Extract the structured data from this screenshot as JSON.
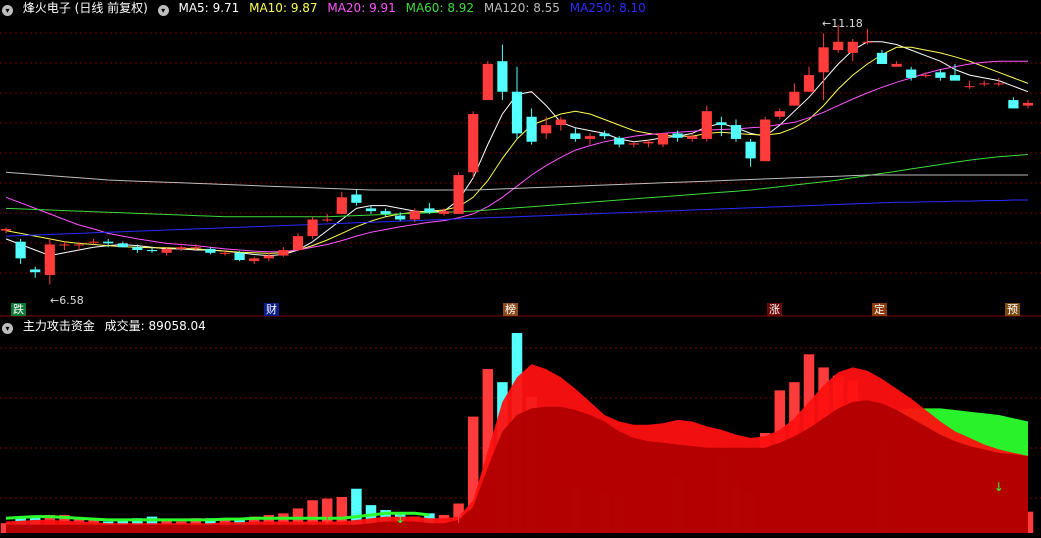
{
  "colors": {
    "background": "#000000",
    "up": "#ff3b3b",
    "down": "#54ffff",
    "ma5": "#ffffff",
    "ma10": "#ffff54",
    "ma20": "#ff54ff",
    "ma60": "#3cdc3c",
    "ma120": "#bdbdbd",
    "ma250": "#2b2bff",
    "grid": "#7a0000",
    "fund_bright": "#ff1010",
    "fund_dark": "#b00000",
    "fund_green": "#2cff2c"
  },
  "header": {
    "title": "烽火电子 (日线 前复权)",
    "ma5_label": "MA5:",
    "ma5_value": "9.71",
    "ma10_label": "MA10:",
    "ma10_value": "9.87",
    "ma20_label": "MA20:",
    "ma20_value": "9.91",
    "ma60_label": "MA60:",
    "ma60_value": "8.92",
    "ma120_label": "MA120:",
    "ma120_value": "8.55",
    "ma250_label": "MA250:",
    "ma250_value": "8.10"
  },
  "sub_header": {
    "indicator": "主力攻击资金",
    "volume_label": "成交量:",
    "volume_value": "89058.04"
  },
  "annotations": {
    "low": "6.58",
    "high": "11.18"
  },
  "markers": [
    {
      "text": "跌",
      "bg": "#0e7a3a",
      "color": "#ffffff"
    },
    {
      "text": "财",
      "bg": "#0a1e8a",
      "color": "#ffffff"
    },
    {
      "text": "榜",
      "bg": "#8a4a1a",
      "color": "#ffffff"
    },
    {
      "text": "涨",
      "bg": "#6a0808",
      "color": "#ffffff"
    },
    {
      "text": "定",
      "bg": "#8a3a0a",
      "color": "#ffffff"
    },
    {
      "text": "预",
      "bg": "#7a4a10",
      "color": "#ffffff"
    }
  ],
  "chart_data": {
    "type": "candlestick",
    "price_range": [
      6.3,
      11.45
    ],
    "candles": [
      [
        7.55,
        7.6,
        7.5,
        7.58
      ],
      [
        7.35,
        7.4,
        6.95,
        7.05
      ],
      [
        6.85,
        6.9,
        6.7,
        6.8
      ],
      [
        6.75,
        7.4,
        6.58,
        7.3
      ],
      [
        7.3,
        7.35,
        7.2,
        7.3
      ],
      [
        7.3,
        7.35,
        7.2,
        7.3
      ],
      [
        7.35,
        7.4,
        7.3,
        7.35
      ],
      [
        7.35,
        7.4,
        7.25,
        7.32
      ],
      [
        7.32,
        7.35,
        7.25,
        7.25
      ],
      [
        7.25,
        7.3,
        7.15,
        7.2
      ],
      [
        7.2,
        7.25,
        7.15,
        7.18
      ],
      [
        7.15,
        7.25,
        7.1,
        7.22
      ],
      [
        7.22,
        7.28,
        7.18,
        7.25
      ],
      [
        7.25,
        7.3,
        7.2,
        7.25
      ],
      [
        7.22,
        7.25,
        7.12,
        7.15
      ],
      [
        7.15,
        7.2,
        7.1,
        7.15
      ],
      [
        7.15,
        7.18,
        7.0,
        7.02
      ],
      [
        7.0,
        7.08,
        6.95,
        7.05
      ],
      [
        7.05,
        7.15,
        7.0,
        7.1
      ],
      [
        7.1,
        7.25,
        7.08,
        7.2
      ],
      [
        7.2,
        7.5,
        7.18,
        7.45
      ],
      [
        7.45,
        7.8,
        7.4,
        7.75
      ],
      [
        7.75,
        7.85,
        7.7,
        7.75
      ],
      [
        7.85,
        8.25,
        7.85,
        8.15
      ],
      [
        8.2,
        8.3,
        8.0,
        8.05
      ],
      [
        7.95,
        8.0,
        7.85,
        7.9
      ],
      [
        7.9,
        7.95,
        7.8,
        7.85
      ],
      [
        7.82,
        7.88,
        7.72,
        7.75
      ],
      [
        7.75,
        7.95,
        7.7,
        7.9
      ],
      [
        7.95,
        8.05,
        7.85,
        7.88
      ],
      [
        7.85,
        7.95,
        7.82,
        7.9
      ],
      [
        7.85,
        8.6,
        7.85,
        8.55
      ],
      [
        8.6,
        9.7,
        8.5,
        9.65
      ],
      [
        9.9,
        10.6,
        9.9,
        10.55
      ],
      [
        10.6,
        10.9,
        9.9,
        10.05
      ],
      [
        10.05,
        10.5,
        9.2,
        9.3
      ],
      [
        9.6,
        9.75,
        9.1,
        9.15
      ],
      [
        9.3,
        9.6,
        9.2,
        9.45
      ],
      [
        9.45,
        9.6,
        9.35,
        9.55
      ],
      [
        9.3,
        9.4,
        9.15,
        9.2
      ],
      [
        9.2,
        9.3,
        9.1,
        9.25
      ],
      [
        9.3,
        9.35,
        9.2,
        9.25
      ],
      [
        9.22,
        9.25,
        9.05,
        9.1
      ],
      [
        9.1,
        9.15,
        9.05,
        9.12
      ],
      [
        9.12,
        9.18,
        9.05,
        9.15
      ],
      [
        9.1,
        9.25,
        9.05,
        9.3
      ],
      [
        9.3,
        9.35,
        9.15,
        9.22
      ],
      [
        9.2,
        9.3,
        9.15,
        9.25
      ],
      [
        9.2,
        9.8,
        9.15,
        9.7
      ],
      [
        9.5,
        9.6,
        9.25,
        9.45
      ],
      [
        9.45,
        9.55,
        9.15,
        9.2
      ],
      [
        9.15,
        9.2,
        8.7,
        8.85
      ],
      [
        8.8,
        9.6,
        8.8,
        9.55
      ],
      [
        9.6,
        9.75,
        9.55,
        9.7
      ],
      [
        9.8,
        10.2,
        9.8,
        10.05
      ],
      [
        10.05,
        10.5,
        10.05,
        10.35
      ],
      [
        10.4,
        11.1,
        9.9,
        10.85
      ],
      [
        10.8,
        11.25,
        10.75,
        10.95
      ],
      [
        10.75,
        11.0,
        10.6,
        10.95
      ],
      [
        10.95,
        11.18,
        10.9,
        10.95
      ],
      [
        10.75,
        10.8,
        10.55,
        10.55
      ],
      [
        10.5,
        10.6,
        10.55,
        10.55
      ],
      [
        10.45,
        10.5,
        10.25,
        10.3
      ],
      [
        10.35,
        10.4,
        10.3,
        10.35
      ],
      [
        10.4,
        10.45,
        10.25,
        10.3
      ],
      [
        10.35,
        10.55,
        10.25,
        10.25
      ],
      [
        10.15,
        10.25,
        10.1,
        10.15
      ],
      [
        10.2,
        10.25,
        10.15,
        10.2
      ],
      [
        10.2,
        10.3,
        10.15,
        10.2
      ],
      [
        9.9,
        9.95,
        9.75,
        9.75
      ],
      [
        9.8,
        9.9,
        9.75,
        9.85
      ]
    ],
    "ma_series": [
      {
        "name": "MA5",
        "key": "ma5",
        "values": [
          7.4,
          7.3,
          7.2,
          7.1,
          7.15,
          7.2,
          7.25,
          7.28,
          7.3,
          7.28,
          7.25,
          7.22,
          7.22,
          7.2,
          7.2,
          7.18,
          7.15,
          7.12,
          7.1,
          7.12,
          7.2,
          7.35,
          7.55,
          7.75,
          7.95,
          8.0,
          8.0,
          7.95,
          7.9,
          7.88,
          7.9,
          8.1,
          8.5,
          9.1,
          9.65,
          10.0,
          10.05,
          9.8,
          9.5,
          9.4,
          9.35,
          9.3,
          9.2,
          9.15,
          9.18,
          9.22,
          9.25,
          9.3,
          9.42,
          9.48,
          9.4,
          9.3,
          9.25,
          9.45,
          9.7,
          9.95,
          10.25,
          10.55,
          10.8,
          10.95,
          10.95,
          10.9,
          10.8,
          10.7,
          10.6,
          10.45,
          10.35,
          10.3,
          10.25,
          10.15,
          10.05
        ]
      },
      {
        "name": "MA10",
        "key": "ma10",
        "values": [
          7.55,
          7.5,
          7.45,
          7.4,
          7.35,
          7.32,
          7.3,
          7.28,
          7.26,
          7.25,
          7.24,
          7.24,
          7.23,
          7.22,
          7.2,
          7.18,
          7.16,
          7.15,
          7.14,
          7.15,
          7.2,
          7.28,
          7.38,
          7.5,
          7.62,
          7.72,
          7.8,
          7.85,
          7.88,
          7.9,
          7.92,
          7.98,
          8.15,
          8.45,
          8.85,
          9.2,
          9.45,
          9.55,
          9.65,
          9.7,
          9.65,
          9.55,
          9.45,
          9.35,
          9.3,
          9.27,
          9.25,
          9.25,
          9.3,
          9.32,
          9.3,
          9.28,
          9.27,
          9.3,
          9.4,
          9.55,
          9.8,
          10.1,
          10.35,
          10.55,
          10.72,
          10.85,
          10.85,
          10.8,
          10.75,
          10.68,
          10.6,
          10.5,
          10.4,
          10.3,
          10.2
        ]
      },
      {
        "name": "MA20",
        "key": "ma20",
        "values": [
          8.15,
          8.05,
          7.95,
          7.85,
          7.75,
          7.65,
          7.58,
          7.5,
          7.45,
          7.4,
          7.36,
          7.32,
          7.3,
          7.28,
          7.25,
          7.22,
          7.2,
          7.18,
          7.17,
          7.17,
          7.2,
          7.25,
          7.3,
          7.37,
          7.45,
          7.52,
          7.57,
          7.62,
          7.66,
          7.7,
          7.73,
          7.78,
          7.85,
          7.98,
          8.15,
          8.35,
          8.55,
          8.72,
          8.87,
          9.0,
          9.08,
          9.15,
          9.2,
          9.25,
          9.28,
          9.3,
          9.32,
          9.34,
          9.36,
          9.37,
          9.38,
          9.4,
          9.42,
          9.46,
          9.5,
          9.58,
          9.68,
          9.8,
          9.92,
          10.03,
          10.13,
          10.22,
          10.3,
          10.38,
          10.45,
          10.5,
          10.55,
          10.58,
          10.6,
          10.6,
          10.6
        ]
      },
      {
        "name": "MA60",
        "key": "ma60",
        "values": [
          7.95,
          7.94,
          7.93,
          7.92,
          7.91,
          7.9,
          7.89,
          7.88,
          7.87,
          7.86,
          7.85,
          7.84,
          7.83,
          7.82,
          7.81,
          7.8,
          7.8,
          7.8,
          7.8,
          7.8,
          7.8,
          7.8,
          7.8,
          7.81,
          7.82,
          7.83,
          7.84,
          7.85,
          7.86,
          7.87,
          7.88,
          7.89,
          7.9,
          7.92,
          7.94,
          7.96,
          7.98,
          8.0,
          8.02,
          8.04,
          8.06,
          8.08,
          8.1,
          8.12,
          8.14,
          8.16,
          8.18,
          8.2,
          8.22,
          8.24,
          8.26,
          8.28,
          8.31,
          8.34,
          8.37,
          8.4,
          8.43,
          8.46,
          8.5,
          8.54,
          8.58,
          8.62,
          8.66,
          8.7,
          8.74,
          8.78,
          8.82,
          8.85,
          8.88,
          8.9,
          8.92
        ]
      },
      {
        "name": "MA120",
        "key": "ma120",
        "values": [
          8.6,
          8.58,
          8.56,
          8.54,
          8.52,
          8.5,
          8.48,
          8.46,
          8.45,
          8.44,
          8.43,
          8.42,
          8.41,
          8.4,
          8.39,
          8.38,
          8.37,
          8.36,
          8.35,
          8.34,
          8.33,
          8.32,
          8.31,
          8.3,
          8.29,
          8.28,
          8.28,
          8.28,
          8.28,
          8.28,
          8.28,
          8.28,
          8.28,
          8.29,
          8.3,
          8.31,
          8.32,
          8.33,
          8.34,
          8.35,
          8.36,
          8.37,
          8.38,
          8.39,
          8.4,
          8.41,
          8.42,
          8.43,
          8.44,
          8.45,
          8.46,
          8.47,
          8.48,
          8.49,
          8.5,
          8.51,
          8.52,
          8.53,
          8.54,
          8.55,
          8.55,
          8.55,
          8.55,
          8.55,
          8.55,
          8.55,
          8.55,
          8.55,
          8.55,
          8.55,
          8.55
        ]
      },
      {
        "name": "MA250",
        "key": "ma250",
        "values": [
          7.45,
          7.46,
          7.47,
          7.48,
          7.49,
          7.5,
          7.51,
          7.52,
          7.53,
          7.54,
          7.55,
          7.56,
          7.57,
          7.58,
          7.59,
          7.6,
          7.61,
          7.62,
          7.63,
          7.64,
          7.65,
          7.66,
          7.67,
          7.68,
          7.69,
          7.7,
          7.71,
          7.72,
          7.73,
          7.74,
          7.75,
          7.76,
          7.77,
          7.78,
          7.79,
          7.8,
          7.81,
          7.82,
          7.83,
          7.84,
          7.85,
          7.86,
          7.87,
          7.88,
          7.89,
          7.9,
          7.91,
          7.92,
          7.93,
          7.94,
          7.95,
          7.96,
          7.97,
          7.98,
          7.99,
          8.0,
          8.01,
          8.02,
          8.03,
          8.04,
          8.05,
          8.06,
          8.06,
          8.07,
          8.07,
          8.08,
          8.08,
          8.09,
          8.09,
          8.1,
          8.1
        ]
      }
    ],
    "volume": [
      6,
      9,
      10,
      11,
      11,
      9,
      8,
      7,
      8,
      9,
      10,
      8,
      7,
      9,
      9,
      8,
      9,
      10,
      11,
      12,
      15,
      20,
      21,
      22,
      27,
      17,
      14,
      12,
      10,
      12,
      11,
      18,
      71,
      100,
      92,
      122,
      83,
      54,
      41,
      30,
      26,
      25,
      24,
      30,
      32,
      31,
      35,
      36,
      40,
      47,
      31,
      25,
      61,
      87,
      92,
      109,
      101,
      96,
      93,
      80,
      55,
      53,
      46,
      43,
      39,
      44,
      34,
      32,
      42,
      32,
      13
    ],
    "fund_bright": [
      7,
      7.5,
      8,
      8,
      7.5,
      7,
      6.5,
      6,
      6,
      6,
      6,
      6,
      6,
      6,
      6,
      6.5,
      6.5,
      7,
      7,
      7,
      7,
      7,
      7,
      7,
      8,
      9,
      10,
      10,
      10,
      9,
      9,
      10,
      20,
      50,
      80,
      95,
      103,
      100,
      95,
      88,
      80,
      72,
      68,
      66,
      66,
      67,
      69,
      68,
      65,
      63,
      60,
      58,
      59,
      63,
      70,
      80,
      90,
      98,
      101,
      99,
      94,
      88,
      82,
      75,
      68,
      62,
      58,
      54,
      51,
      49,
      47
    ],
    "fund_dark": [
      5,
      5,
      5,
      5,
      5,
      5,
      5,
      5,
      5,
      5,
      5,
      5,
      5,
      5,
      5,
      5,
      5,
      5,
      5,
      5,
      5,
      5,
      5,
      5,
      5,
      6,
      7,
      7,
      7,
      6,
      6,
      8,
      16,
      40,
      62,
      72,
      76,
      77,
      77,
      75,
      72,
      68,
      62,
      58,
      56,
      55,
      54,
      53,
      52,
      52,
      52,
      52,
      52,
      55,
      59,
      64,
      70,
      76,
      80,
      81,
      79,
      75,
      70,
      65,
      60,
      56,
      53,
      51,
      49,
      48,
      47
    ],
    "fund_green": [
      0,
      0,
      0,
      0,
      0,
      0,
      0,
      0,
      0,
      0,
      0,
      0,
      0,
      0,
      0,
      0,
      0,
      0,
      0,
      0,
      0,
      0,
      0,
      0,
      0,
      0,
      0,
      0,
      0,
      0,
      0,
      0,
      0,
      0,
      0,
      0,
      0,
      0,
      0,
      0,
      0,
      0,
      0,
      0,
      0,
      0,
      0,
      0,
      0,
      0,
      0,
      0,
      0,
      0,
      0,
      0,
      0,
      0,
      0,
      0,
      0,
      75,
      76,
      76,
      76,
      75,
      74,
      73,
      72,
      70,
      68
    ]
  }
}
